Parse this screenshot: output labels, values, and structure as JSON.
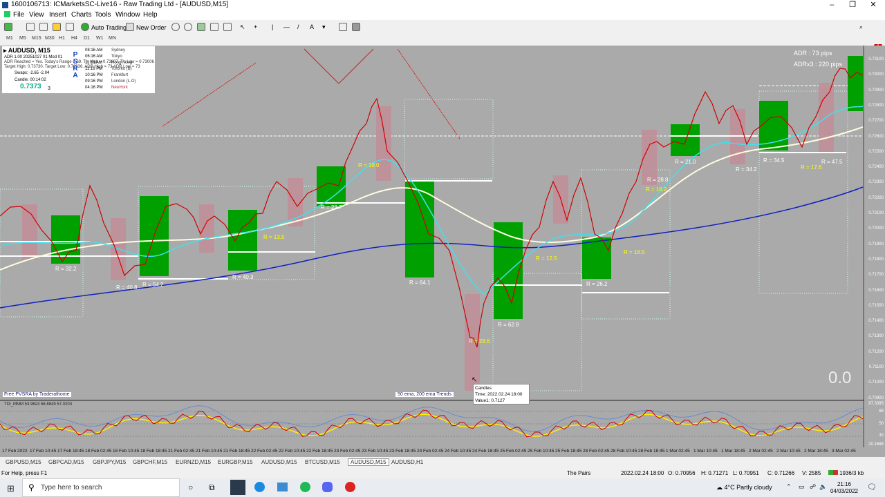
{
  "window": {
    "title": "1600106713: ICMarketsSC-Live16 - Raw Trading Ltd - [AUDUSD,M15]",
    "min": "–",
    "max": "❐",
    "close": "✕"
  },
  "menu": [
    "File",
    "View",
    "Insert",
    "Charts",
    "Tools",
    "Window",
    "Help"
  ],
  "toolbar": {
    "autotrading": "Auto Trading",
    "neworder": "New Order"
  },
  "timeframes": [
    "M1",
    "M5",
    "M15",
    "M30",
    "H1",
    "H4",
    "D1",
    "W1",
    "MN"
  ],
  "infobox": {
    "symbol": "AUDUSD, M15",
    "adr_line": "ADR 1.00 20251027 01 Mod 01",
    "adr_reached": "ADR Reached = Yes. Today's Range = 69. T's High = 0.73807, T's Low = 0.73006",
    "targets": "Target High: 0.73730. Target Low: 0.72936. ADR High = 73 ADR Low = 73",
    "swaps": "Swaps: -2.65 -2.04",
    "candle": "Candle: 00:14:02",
    "price": "0.7373",
    "price_small": "3",
    "psra": [
      "P",
      "S",
      "R",
      "A"
    ],
    "sessions": [
      {
        "time": "08:16 AM",
        "city": "Sydney"
      },
      {
        "time": "06:16 AM",
        "city": "Tokyo"
      },
      {
        "time": "11:16 AM",
        "city": "Hong Kong"
      },
      {
        "time": "11:16 PM",
        "city": "Toronto (B)"
      },
      {
        "time": "10:16 PM",
        "city": "Frankfurt"
      },
      {
        "time": "09:16 PM",
        "city": "London (L.O)"
      },
      {
        "time": "04:16 PM",
        "city": "NewYork"
      }
    ]
  },
  "adr": {
    "line1": "ADR : 73 pips",
    "line2": "ADRx3 : 220 pips"
  },
  "big_value": "0.0",
  "free_label": "Free PVSRA by Traderathome",
  "ema_label": "50 ema, 200 ema Trends",
  "tooltip": {
    "line1": "Candles",
    "line2": "Time: 2022.02.24 18:00",
    "line3": "Value1: 0.7127"
  },
  "range_labels": [
    {
      "text": "R = 32.2",
      "color": "white"
    },
    {
      "text": "R = 40.8",
      "color": "white"
    },
    {
      "text": "R = 54.2",
      "color": "white"
    },
    {
      "text": "R = 40.3",
      "color": "white"
    },
    {
      "text": "R = 13.5",
      "color": "yellow"
    },
    {
      "text": "R = 23.7",
      "color": "white"
    },
    {
      "text": "R = 19.0",
      "color": "yellow"
    },
    {
      "text": "R = 64.1",
      "color": "white"
    },
    {
      "text": "R = 28.6",
      "color": "yellow"
    },
    {
      "text": "R = 62.8",
      "color": "white"
    },
    {
      "text": "R = 12.5",
      "color": "yellow"
    },
    {
      "text": "R = 26.2",
      "color": "white"
    },
    {
      "text": "R = 16.5",
      "color": "yellow"
    },
    {
      "text": "R = 28.8",
      "color": "white"
    },
    {
      "text": "R = 16.2",
      "color": "yellow"
    },
    {
      "text": "R = 21.0",
      "color": "white"
    },
    {
      "text": "R = 34.2",
      "color": "white"
    },
    {
      "text": "R = 34.5",
      "color": "white"
    },
    {
      "text": "R = 17.6",
      "color": "yellow"
    },
    {
      "text": "R = 47.5",
      "color": "white"
    }
  ],
  "price_axis": [
    "0.73100",
    "0.73000",
    "0.72900",
    "0.72800",
    "0.72700",
    "0.72600",
    "0.72500",
    "0.72400",
    "0.72300",
    "0.72200",
    "0.72100",
    "0.72000",
    "0.71900",
    "0.71800",
    "0.71700",
    "0.71600",
    "0.71500",
    "0.71400",
    "0.71300",
    "0.71200",
    "0.71100",
    "0.71000",
    "0.70900"
  ],
  "indicator": {
    "label": "TDI_MMM 53.9624 56.8849 57.0203",
    "levels": [
      "87.3395",
      "68",
      "50",
      "32",
      "20.1698"
    ]
  },
  "time_axis": [
    "17 Feb 2022",
    "17 Feb 10:45",
    "17 Feb 18:45",
    "18 Feb 02:45",
    "18 Feb 10:45",
    "18 Feb 18:45",
    "21 Feb 02:45",
    "21 Feb 10:45",
    "21 Feb 18:45",
    "22 Feb 02:45",
    "22 Feb 10:45",
    "22 Feb 18:45",
    "23 Feb 02:45",
    "23 Feb 10:45",
    "23 Feb 18:45",
    "24 Feb 02:45",
    "24 Feb 10:45",
    "24 Feb 18:45",
    "25 Feb 02:45",
    "25 Feb 10:45",
    "25 Feb 18:45",
    "28 Feb 02:45",
    "28 Feb 10:45",
    "28 Feb 18:45",
    "1 Mar 02:45",
    "1 Mar 10:45",
    "1 Mar 18:45",
    "2 Mar 02:45",
    "2 Mar 10:45",
    "2 Mar 18:45",
    "3 Mar 02:45"
  ],
  "tabs": [
    "GBPUSD,M15",
    "GBPCAD,M15",
    "GBPJPY,M15",
    "GBPCHF,M15",
    "EURNZD,M15",
    "EURGBP,M15",
    "AUDUSD,M15",
    "BTCUSD,M15",
    "AUDUSD,M15",
    "AUDUSD,H1"
  ],
  "active_tab": 8,
  "status": {
    "help": "For Help, press F1",
    "pairs": "The Pairs",
    "time": "2022.02.24 18:00",
    "open": "O: 0.70956",
    "high": "H: 0.71271",
    "low": "L: 0.70951",
    "close": "C: 0.71266",
    "vol": "V: 2585",
    "traffic": "1936/3 kb"
  },
  "taskbar": {
    "search": "Type here to search",
    "weather": "4°C  Partly cloudy",
    "clock_time": "21:16",
    "clock_date": "04/03/2022"
  },
  "colors": {
    "chart_bg": "#aaaaaa",
    "bull_box": "#00a000",
    "bear_box": "#c08f98",
    "ema50": "#fffde0",
    "ema200": "#1020c0",
    "fast": "#d00000",
    "cyan": "#40e0f0"
  }
}
